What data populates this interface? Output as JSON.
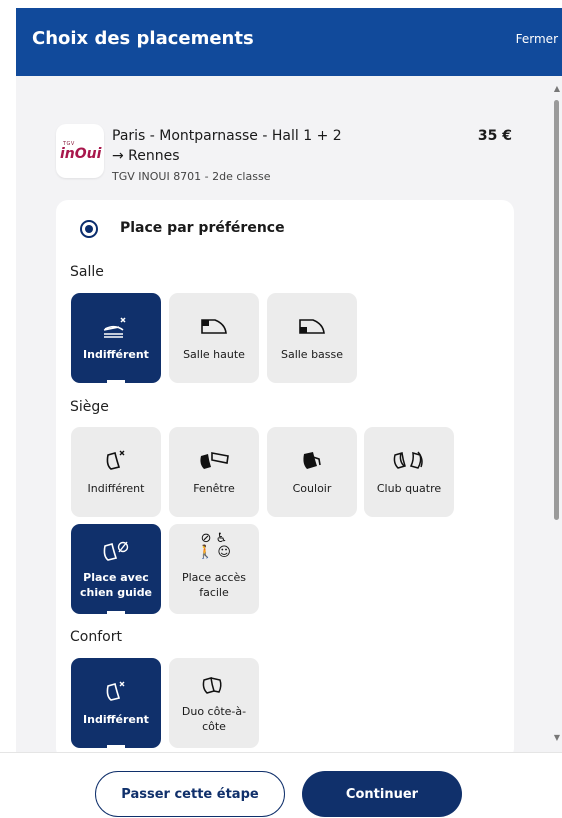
{
  "header": {
    "title": "Choix des placements",
    "close_label": "Fermer"
  },
  "trip": {
    "logo_small": "TGV",
    "logo_brand": "inOui",
    "route_line1": "Paris - Montparnasse - Hall 1 + 2",
    "route_line2": "→ Rennes",
    "train": "TGV INOUI 8701 - 2de classe",
    "price": "35 €"
  },
  "preference": {
    "label": "Place par préférence",
    "selected": true
  },
  "sections": {
    "salle": {
      "title": "Salle",
      "options": [
        "Indifférent",
        "Salle haute",
        "Salle basse"
      ],
      "selected": "Indifférent"
    },
    "siege": {
      "title": "Siège",
      "options": [
        "Indifférent",
        "Fenêtre",
        "Couloir",
        "Club quatre",
        "Place avec chien guide",
        "Place accès facile"
      ],
      "selected": "Place avec chien guide"
    },
    "confort": {
      "title": "Confort",
      "options": [
        "Indifférent",
        "Duo côte-à-côte"
      ],
      "selected": "Indifférent"
    }
  },
  "footer": {
    "skip_label": "Passer cette étape",
    "continue_label": "Continuer"
  },
  "colors": {
    "header_bg": "#114a9b",
    "selected_tile": "#10306b",
    "tile_bg": "#ececec",
    "content_bg": "#f3f3f5"
  }
}
